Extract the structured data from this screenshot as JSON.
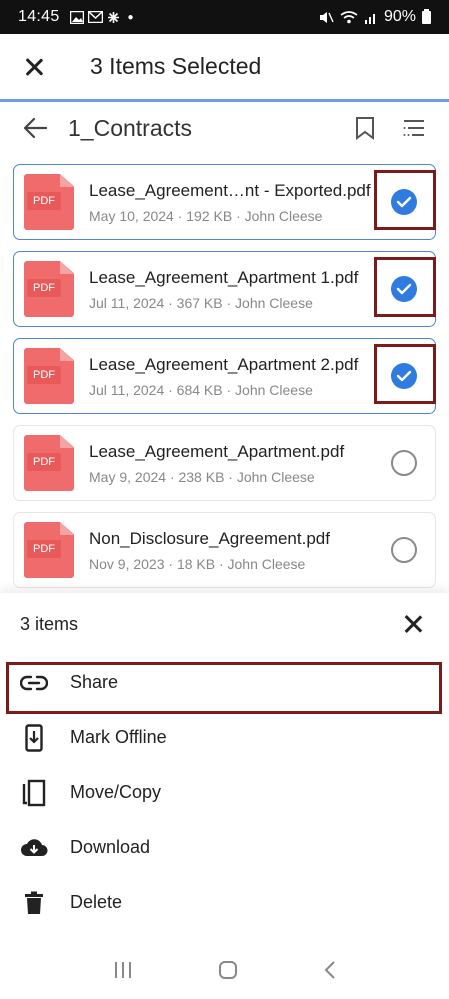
{
  "status": {
    "time": "14:45",
    "icons": [
      "photo-icon",
      "gmail-icon",
      "pinwheel-icon"
    ],
    "battery": "90%"
  },
  "header": {
    "title": "3 Items Selected"
  },
  "folder": {
    "name": "1_Contracts"
  },
  "files": [
    {
      "name": "Lease_Agreement…nt - Exported.pdf",
      "meta": "May 10, 2024 · 192 KB · John Cleese",
      "selected": true,
      "pdf_label": "PDF"
    },
    {
      "name": "Lease_Agreement_Apartment 1.pdf",
      "meta": "Jul 11, 2024 · 367 KB · John Cleese",
      "selected": true,
      "pdf_label": "PDF"
    },
    {
      "name": "Lease_Agreement_Apartment 2.pdf",
      "meta": "Jul 11, 2024 · 684 KB · John Cleese",
      "selected": true,
      "pdf_label": "PDF"
    },
    {
      "name": "Lease_Agreement_Apartment.pdf",
      "meta": "May 9, 2024 · 238 KB · John Cleese",
      "selected": false,
      "pdf_label": "PDF"
    },
    {
      "name": "Non_Disclosure_Agreement.pdf",
      "meta": "Nov 9, 2023 · 18 KB · John Cleese",
      "selected": false,
      "pdf_label": "PDF"
    }
  ],
  "sheet": {
    "count": "3 items",
    "actions": [
      {
        "label": "Share",
        "icon": "link-icon"
      },
      {
        "label": "Mark Offline",
        "icon": "offline-icon"
      },
      {
        "label": "Move/Copy",
        "icon": "copy-icon"
      },
      {
        "label": "Download",
        "icon": "cloud-download-icon"
      },
      {
        "label": "Delete",
        "icon": "trash-icon"
      }
    ]
  },
  "colors": {
    "accent": "#2f7bdf",
    "pdf": "#f06b6b",
    "highlight": "#7d1b1b"
  }
}
